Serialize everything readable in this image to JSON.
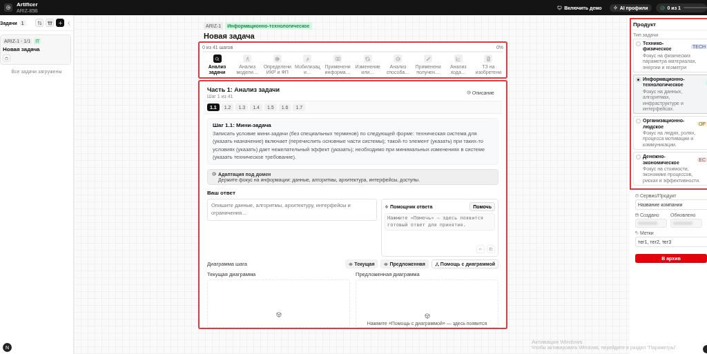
{
  "top_bar": {
    "app_name": "Artificer",
    "project_code": "ARIZ-85B",
    "demo_button": "Включить демо",
    "ai_profiles_button": "AI профили",
    "progress": {
      "label": "0 из 1",
      "level": 0
    }
  },
  "sidebar": {
    "title": "Задачи",
    "count": "1",
    "tasks": [
      {
        "code": "ARIZ-1 · 1/1",
        "badge": "IT",
        "title": "Новая задача"
      }
    ],
    "footer": "Все задачи загружены",
    "avatar": "N"
  },
  "task": {
    "code": "ARIZ-1",
    "domain": "Информационно-технологическое",
    "title": "Новая задача"
  },
  "stepper": {
    "progress_label": "0 из 41 шагов",
    "percent": "0%",
    "level": 0,
    "steps": [
      {
        "label": "Анализ задачи",
        "selected": true
      },
      {
        "label": "Анализ модели…",
        "selected": false
      },
      {
        "label": "Определени ИКР и ФП",
        "selected": false
      },
      {
        "label": "Мобилизац и…",
        "selected": false
      },
      {
        "label": "Применени информа…",
        "selected": false
      },
      {
        "label": "Изменение или…",
        "selected": false
      },
      {
        "label": "Анализ способа…",
        "selected": false
      },
      {
        "label": "Применени получен…",
        "selected": false
      },
      {
        "label": "Анализ хода…",
        "selected": false
      },
      {
        "label": "ТЗ на изобретени",
        "selected": false
      }
    ]
  },
  "part": {
    "title": "Часть 1: Анализ задачи",
    "subtitle": "Шаг 1 из 41",
    "description_button": "Описание",
    "substeps": [
      {
        "label": "1.1",
        "selected": true
      },
      {
        "label": "1.2",
        "selected": false
      },
      {
        "label": "1.3",
        "selected": false
      },
      {
        "label": "1.4",
        "selected": false
      },
      {
        "label": "1.5",
        "selected": false
      },
      {
        "label": "1.6",
        "selected": false
      },
      {
        "label": "1.7",
        "selected": false
      }
    ],
    "step": {
      "title": "Шаг 1.1: Мини-задача",
      "text": "Записать условие мини-задачи (без специальных терминов) по следующей форме: техническая система для (указать назначение) включает (перечислить основные части системы); такой-то элемент (указать) при таких-то условиях (указать) дает нежелательный эффект (указать); необходимо при минимальных изменениях в системе (указать техническое требование)."
    },
    "domain_note": {
      "title": "Адаптация под домен",
      "text": "Держите фокус на информации: данные, алгоритмы, архитектура, интерфейсы, доступы."
    },
    "answer": {
      "label": "Ваш ответ",
      "placeholder": "Опишите данные, алгоритмы, архитектуру, интерфейсы и ограничения..."
    },
    "helper": {
      "title": "Помощник ответа",
      "button": "Помочь",
      "text": "Нажмите «Помочь» — здесь появится готовый ответ для принятия."
    },
    "diagram": {
      "label": "Диаграмма шага",
      "buttons": [
        "Текущая",
        "Предложенная",
        "Помощь с диаграммой"
      ],
      "current_title": "Текущая диаграмма",
      "proposed_title": "Предложенная диаграмма",
      "proposed_hint": "Нажмите «Помощь с диаграммой» — здесь появится"
    }
  },
  "product_panel": {
    "title": "Продукт",
    "type_label": "Тип задачи",
    "task_types": [
      {
        "title": "Технико-физическое",
        "badge": "TECH",
        "color": "#dbe6fe",
        "description": "Фокус на физических параметра материалах, энергии и геометри",
        "selected": false
      },
      {
        "title": "Информационно-технологическое",
        "color": "#d6f5e3",
        "description": "Фокус на данных, алгоритмах, инфраструктуре и интерфейсах.",
        "selected": true
      },
      {
        "title": "Организационно-людское",
        "badge": "OP",
        "color": "#fdf0c4",
        "description": "Фокус на людях, ролях, процесса мотивации и коммуникации.",
        "selected": false
      },
      {
        "title": "Денежно-экономическое",
        "badge": "EC",
        "color": "#fde0e0",
        "description": "Фокус на стоимости, экономике процессов, рисках и эффективности.",
        "selected": false
      }
    ],
    "service_label": "Сервис/Продукт",
    "service_value": "Название компании",
    "created_label": "Создано",
    "updated_label": "Обновлено",
    "tags_label": "Метки",
    "tags_value": "тег1, тег2, тег3",
    "archive_button": "В архив"
  },
  "os_notice": {
    "title": "Активация Windows",
    "text": "Чтобы активировать Windows, перейдите в раздел \"Параметры\"."
  }
}
